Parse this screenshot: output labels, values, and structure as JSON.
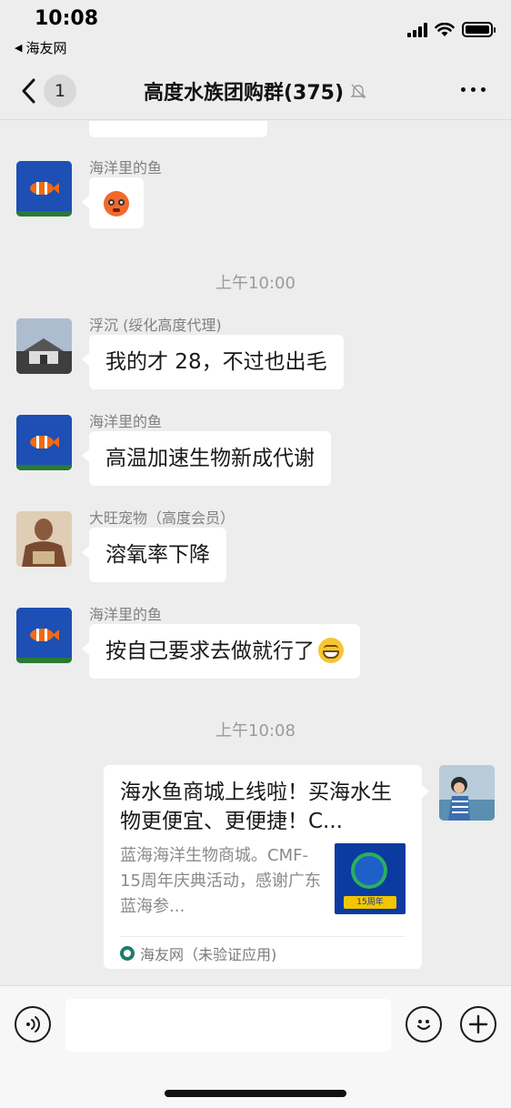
{
  "status_bar": {
    "time": "10:08",
    "back_app": "海友网"
  },
  "nav": {
    "unread_count": "1",
    "title": "高度水族团购群(375)"
  },
  "messages": [
    {
      "sender": "海洋里的鱼",
      "type": "emoji",
      "avatar": "clownfish"
    },
    {
      "type": "timestamp",
      "text": "上午10:00"
    },
    {
      "sender": "浮沉 (绥化高度代理)",
      "text": "我的才 28，不过也出毛",
      "avatar": "temple"
    },
    {
      "sender": "海洋里的鱼",
      "text": "高温加速生物新成代谢",
      "avatar": "clownfish"
    },
    {
      "sender": "大旺宠物（高度会员）",
      "text": "溶氧率下降",
      "avatar": "muscle-man"
    },
    {
      "sender": "海洋里的鱼",
      "text": "按自己要求去做就行了",
      "emoji": "grin",
      "avatar": "clownfish"
    },
    {
      "type": "timestamp",
      "text": "上午10:08"
    }
  ],
  "link_card": {
    "title": "海水鱼商城上线啦！买海水生物更便宜、更便捷！C...",
    "description": "蓝海海洋生物商城。CMF-15周年庆典活动，感谢广东蓝海参...",
    "thumb_label": "15周年",
    "source": "海友网（未验证应用)",
    "avatar": "child-photo"
  },
  "input_bar": {
    "placeholder": ""
  },
  "colors": {
    "background": "#ededed",
    "bubble": "#ffffff",
    "text": "#191919",
    "muted": "#9b9b9b"
  }
}
